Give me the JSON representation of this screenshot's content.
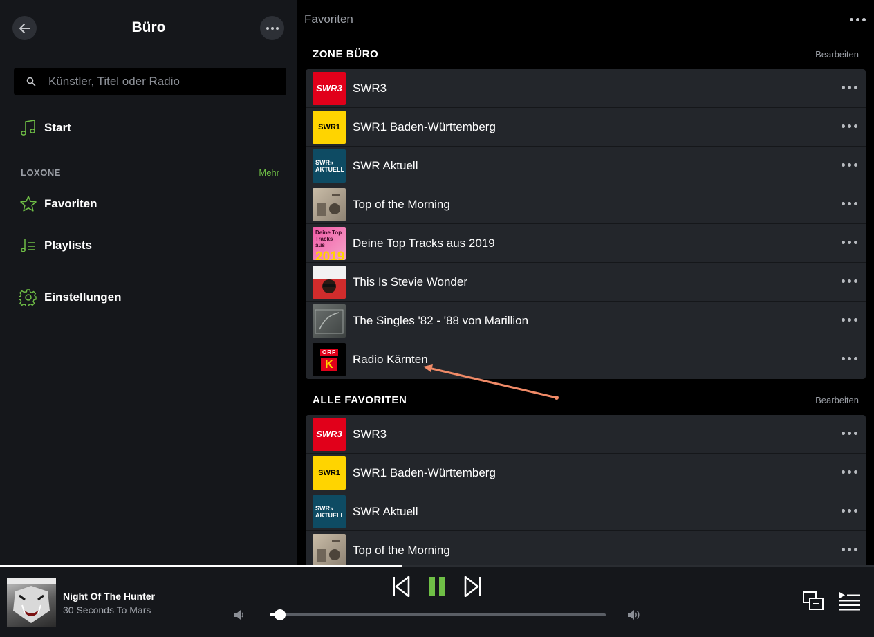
{
  "sidebar": {
    "zone_title": "Büro",
    "search_placeholder": "Künstler, Titel oder Radio",
    "start_label": "Start",
    "section_label": "LOXONE",
    "more_label": "Mehr",
    "favorites_label": "Favoriten",
    "playlists_label": "Playlists",
    "settings_label": "Einstellungen"
  },
  "main": {
    "title": "Favoriten",
    "zone_section": {
      "heading": "ZONE BÜRO",
      "edit_label": "Bearbeiten",
      "items": [
        {
          "title": "SWR3",
          "art": "SWR3"
        },
        {
          "title": "SWR1 Baden-Württemberg",
          "art": "SWR1"
        },
        {
          "title": "SWR Aktuell",
          "art_line1": "SWR»",
          "art_line2": "AKTUELL"
        },
        {
          "title": "Top of the Morning"
        },
        {
          "title": "Deine Top Tracks aus 2019",
          "art_line1": "Deine Top Tracks aus",
          "art_line2": "2019"
        },
        {
          "title": "This Is Stevie Wonder"
        },
        {
          "title": "The Singles '82 - '88 von Marillion"
        },
        {
          "title": "Radio Kärnten",
          "art_line1": "ORF",
          "art_line2": "K"
        }
      ]
    },
    "all_section": {
      "heading": "ALLE FAVORITEN",
      "edit_label": "Bearbeiten",
      "items": [
        {
          "title": "SWR3",
          "art": "SWR3"
        },
        {
          "title": "SWR1 Baden-Württemberg",
          "art": "SWR1"
        },
        {
          "title": "SWR Aktuell",
          "art_line1": "SWR»",
          "art_line2": "AKTUELL"
        },
        {
          "title": "Top of the Morning"
        }
      ]
    }
  },
  "player": {
    "track_title": "Night Of The Hunter",
    "track_artist": "30 Seconds To Mars",
    "volume_fraction": 0.03,
    "track_progress_fraction": 0.46
  },
  "colors": {
    "accent": "#6fbf46",
    "annotation_arrow": "#f08a67"
  }
}
